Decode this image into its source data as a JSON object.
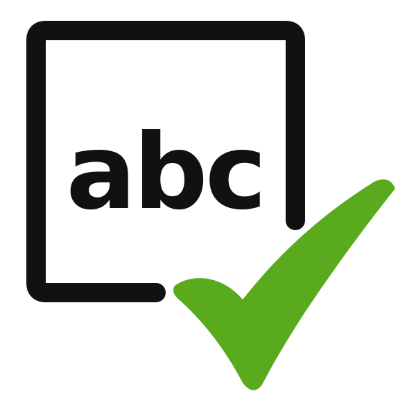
{
  "icon": {
    "name": "spell-check-icon",
    "text": "abc",
    "colors": {
      "frame": "#111111",
      "text": "#111111",
      "check": "#5aaa1e",
      "background": "#ffffff"
    }
  }
}
